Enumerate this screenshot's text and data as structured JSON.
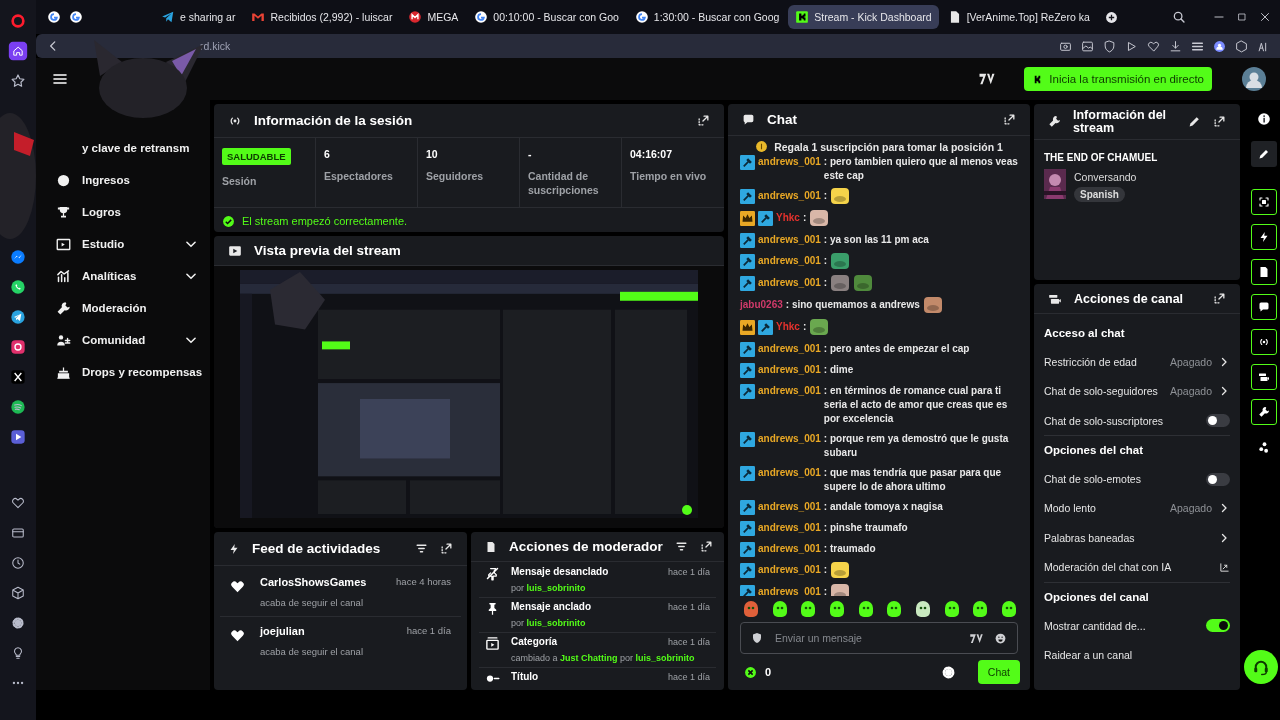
{
  "browser": {
    "tabs": [
      {
        "label": "e sharing ar",
        "selected": false
      },
      {
        "label": "Recibidos (2,992) - luiscar",
        "selected": false
      },
      {
        "label": "MEGA",
        "selected": false
      },
      {
        "label": "00:10:00 - Buscar con Goo",
        "selected": false
      },
      {
        "label": "1:30:00 - Buscar con Goog",
        "selected": false
      },
      {
        "label": "Stream - Kick Dashboard",
        "selected": true
      },
      {
        "label": "[VerAnime.Top] ReZero ka",
        "selected": false
      }
    ],
    "address": "rd.kick"
  },
  "header": {
    "go_live_button": "Inicia la transmisión en directo"
  },
  "sidebar": {
    "items": [
      {
        "label": "y clave de retransm"
      },
      {
        "label": "Ingresos"
      },
      {
        "label": "Logros"
      },
      {
        "label": "Estudio",
        "expanded": false
      },
      {
        "label": "Analíticas",
        "expanded": false
      },
      {
        "label": "Moderación"
      },
      {
        "label": "Comunidad",
        "expanded": false
      },
      {
        "label": "Drops y recompensas"
      }
    ]
  },
  "session": {
    "title": "Información de la sesión",
    "status_badge": "SALUDABLE",
    "status_label": "Sesión",
    "stats": [
      {
        "value": "6",
        "label": "Espectadores"
      },
      {
        "value": "10",
        "label": "Seguidores"
      },
      {
        "value": "-",
        "label": "Cantidad de suscripciones"
      },
      {
        "value": "04:16:07",
        "label": "Tiempo en vivo"
      }
    ],
    "message": "El stream empezó correctamente."
  },
  "preview": {
    "title": "Vista previa del stream",
    "kind": "picture"
  },
  "activity_feed": {
    "title": "Feed de actividades",
    "items": [
      {
        "user": "CarlosShowsGames",
        "text": "acaba de seguir el canal",
        "time": "hace 4 horas"
      },
      {
        "user": "joejulian",
        "text": "acaba de seguir el canal",
        "time": "hace 1 día"
      }
    ]
  },
  "mod_actions": {
    "title": "Acciones de moderador",
    "items": [
      {
        "kind": "unpin",
        "action": "Mensaje desanclado",
        "detail": "por **luis_sobrinito**",
        "time": "hace 1 día"
      },
      {
        "kind": "pin",
        "action": "Mensaje anclado",
        "detail": "por **luis_sobrinito**",
        "time": "hace 1 día"
      },
      {
        "kind": "category",
        "action": "Categoría",
        "detail": "cambiado a **Just Chatting** por **luis_sobrinito**",
        "time": "hace 1 día"
      },
      {
        "kind": "title",
        "action": "Título",
        "time": "hace 1 día"
      }
    ]
  },
  "chat": {
    "title": "Chat",
    "pinned": "Regala 1 suscripción para tomar la posición 1",
    "messages": [
      {
        "badges": [
          {
            "kind": "mod"
          }
        ],
        "user": "andrews_001",
        "color": "#e9a825",
        "text": ": pero tambien quiero que al menos veas este cap"
      },
      {
        "badges": [
          {
            "kind": "mod"
          }
        ],
        "user": "andrews_001",
        "color": "#e9a825",
        "text": ":",
        "emotes": [
          {
            "kind": "picture"
          }
        ]
      },
      {
        "badges": [
          {
            "kind": "crown"
          },
          {
            "kind": "mod"
          }
        ],
        "user": "Yhkc",
        "color": "#e5322d",
        "text": ":",
        "emotes": [
          {
            "kind": "picture"
          }
        ]
      },
      {
        "badges": [
          {
            "kind": "mod"
          }
        ],
        "user": "andrews_001",
        "color": "#e9a825",
        "text": ": ya son las 11 pm aca"
      },
      {
        "badges": [
          {
            "kind": "mod"
          }
        ],
        "user": "andrews_001",
        "color": "#e9a825",
        "text": ":",
        "emotes": [
          {
            "kind": "picture"
          }
        ]
      },
      {
        "badges": [
          {
            "kind": "mod"
          }
        ],
        "user": "andrews_001",
        "color": "#e9a825",
        "text": ":",
        "emotes": [
          {
            "kind": "picture"
          },
          {
            "kind": "picture"
          }
        ]
      },
      {
        "user": "jabu0263",
        "color": "#d03a6a",
        "text": ": sino quemamos a andrews",
        "emotes": [
          {
            "kind": "picture"
          }
        ]
      },
      {
        "badges": [
          {
            "kind": "crown"
          },
          {
            "kind": "mod"
          }
        ],
        "user": "Yhkc",
        "color": "#e5322d",
        "text": ":",
        "emotes": [
          {
            "kind": "picture"
          }
        ]
      },
      {
        "badges": [
          {
            "kind": "mod"
          }
        ],
        "user": "andrews_001",
        "color": "#e9a825",
        "text": ": pero antes de empezar el cap"
      },
      {
        "badges": [
          {
            "kind": "mod"
          }
        ],
        "user": "andrews_001",
        "color": "#e9a825",
        "text": ": dime"
      },
      {
        "badges": [
          {
            "kind": "mod"
          }
        ],
        "user": "andrews_001",
        "color": "#e9a825",
        "text": ": en términos de romance cual para ti seria el acto de amor que creas que es por excelencia"
      },
      {
        "badges": [
          {
            "kind": "mod"
          }
        ],
        "user": "andrews_001",
        "color": "#e9a825",
        "text": ": porque rem ya demostró que le gusta subaru"
      },
      {
        "badges": [
          {
            "kind": "mod"
          }
        ],
        "user": "andrews_001",
        "color": "#e9a825",
        "text": ": que mas tendría que pasar para que supere lo de ahora ultimo"
      },
      {
        "badges": [
          {
            "kind": "mod"
          }
        ],
        "user": "andrews_001",
        "color": "#e9a825",
        "text": ": andale tomoya x nagisa"
      },
      {
        "badges": [
          {
            "kind": "mod"
          }
        ],
        "user": "andrews_001",
        "color": "#e9a825",
        "text": ": pinshe traumafo"
      },
      {
        "badges": [
          {
            "kind": "mod"
          }
        ],
        "user": "andrews_001",
        "color": "#e9a825",
        "text": ": traumado"
      },
      {
        "badges": [
          {
            "kind": "mod"
          }
        ],
        "user": "andrews_001",
        "color": "#e9a825",
        "text": ":",
        "emotes": [
          {
            "kind": "picture"
          }
        ]
      },
      {
        "badges": [
          {
            "kind": "mod"
          }
        ],
        "user": "andrews_001",
        "color": "#e9a825",
        "text": ":",
        "emotes": [
          {
            "kind": "picture"
          }
        ]
      }
    ],
    "input_placeholder": "Enviar un mensaje",
    "points": "0",
    "send_button": "Chat"
  },
  "stream_info": {
    "title": "Información del stream",
    "stream_title": "THE END OF CHAMUEL",
    "category": "Conversando",
    "tag": "Spanish"
  },
  "channel_actions": {
    "title": "Acciones de canal",
    "rows": [
      {
        "kind": "heading",
        "label": "Acceso al chat"
      },
      {
        "kind": "value",
        "label": "Restricción de edad",
        "value": "Apagado"
      },
      {
        "kind": "value",
        "label": "Chat de solo-seguidores",
        "value": "Apagado"
      },
      {
        "kind": "toggle",
        "label": "Chat de solo-suscriptores",
        "on": false
      },
      {
        "kind": "heading",
        "label": "Opciones del chat"
      },
      {
        "kind": "toggle",
        "label": "Chat de solo-emotes",
        "on": false
      },
      {
        "kind": "value",
        "label": "Modo lento",
        "value": "Apagado"
      },
      {
        "kind": "link",
        "label": "Palabras baneadas"
      },
      {
        "kind": "external",
        "label": "Moderación del chat con IA"
      },
      {
        "kind": "heading",
        "label": "Opciones del canal"
      },
      {
        "kind": "toggle",
        "label": "Mostrar cantidad de...",
        "on": true
      },
      {
        "kind": "plain",
        "label": "Raidear a un canal"
      }
    ]
  }
}
